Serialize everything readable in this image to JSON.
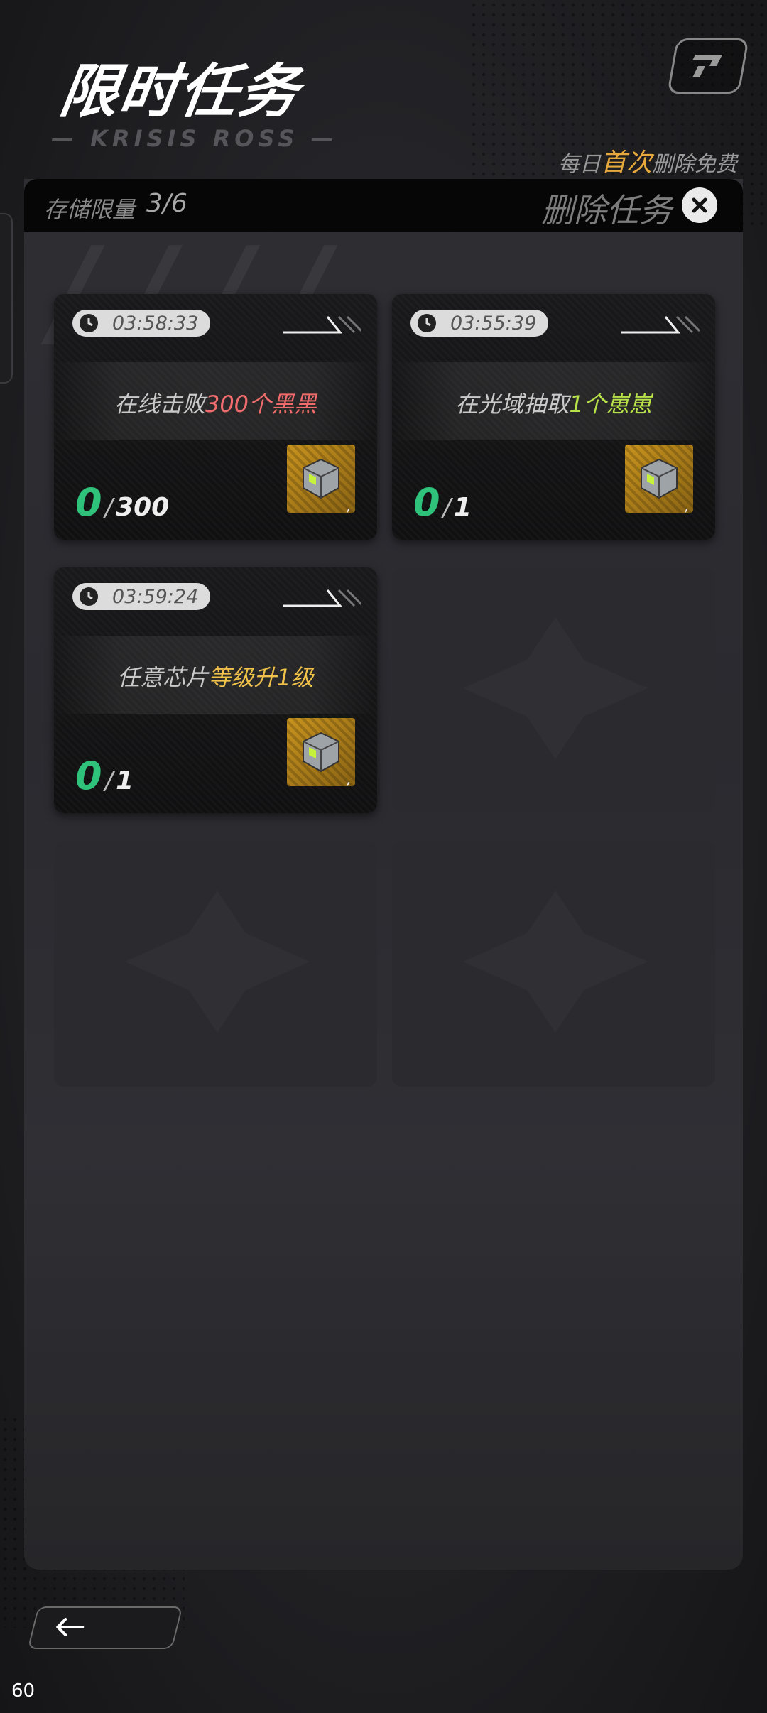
{
  "header": {
    "title": "限时任务",
    "decor_text": "— KRISIS ROSS —",
    "free_note_prefix": "每日",
    "free_note_highlight": "首次",
    "free_note_suffix": "删除免费"
  },
  "storage": {
    "label": "存储限量",
    "count": "3/6",
    "delete_label": "删除任务"
  },
  "missions": [
    {
      "timer": "03:58:33",
      "text_prefix": "在线击败",
      "text_highlight": "300个黑黑",
      "highlight_color": "#f06c6c",
      "progress_current": "0",
      "progress_total": "300",
      "reward_count": ","
    },
    {
      "timer": "03:55:39",
      "text_prefix": "在光域抽取",
      "text_highlight": "1个崽崽",
      "highlight_color": "#b8e24a",
      "progress_current": "0",
      "progress_total": "1",
      "reward_count": ","
    },
    {
      "timer": "03:59:24",
      "text_prefix": "任意芯片",
      "text_highlight": "等级升1级",
      "highlight_color": "#f0c24a",
      "progress_current": "0",
      "progress_total": "1",
      "reward_count": ","
    }
  ],
  "empty_slots": 3,
  "footer": {
    "fps": "60"
  },
  "icons": {
    "top_right": "logo-icon",
    "delete": "close-icon",
    "timer": "clock-icon",
    "reward": "cube-icon",
    "back": "arrow-left-icon"
  }
}
